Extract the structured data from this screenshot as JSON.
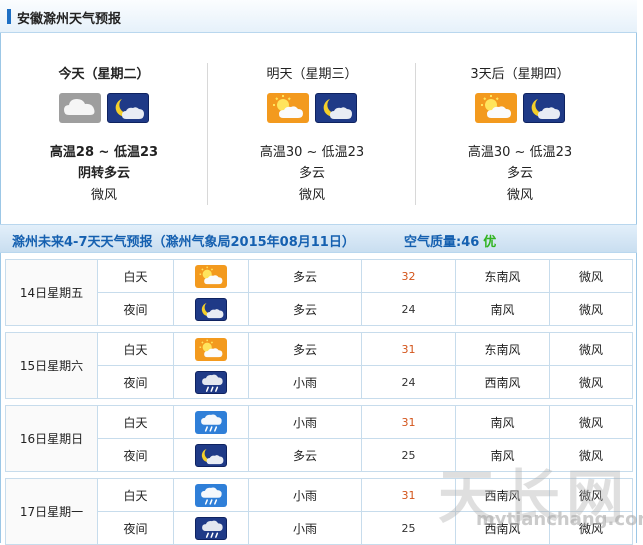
{
  "title": "安徽滁州天气预报",
  "today": [
    {
      "name": "今天（星期二）",
      "icons": [
        "cloud-icon",
        "night-cloud-icon"
      ],
      "temp": "高温28 ~ 低温23",
      "cond": "阴转多云",
      "wind": "微风"
    },
    {
      "name": "明天（星期三）",
      "icons": [
        "sun-cloud-icon",
        "night-cloud-icon"
      ],
      "temp": "高温30 ~ 低温23",
      "cond": "多云",
      "wind": "微风"
    },
    {
      "name": "3天后（星期四）",
      "icons": [
        "sun-cloud-icon",
        "night-cloud-icon"
      ],
      "temp": "高温30 ~ 低温23",
      "cond": "多云",
      "wind": "微风"
    }
  ],
  "sub": {
    "title": "滁州未来4-7天天气预报（滁州气象局2015年08月11日）",
    "aq_label": "空气质量:",
    "aq_value": "46",
    "aq_grade": "优"
  },
  "forecast": [
    {
      "date": "14日星期五",
      "rows": [
        {
          "period": "白天",
          "icon": "sun-cloud-icon",
          "cond": "多云",
          "temp": "32",
          "dir": "东南风",
          "wind": "微风"
        },
        {
          "period": "夜间",
          "icon": "night-cloud-icon",
          "cond": "多云",
          "temp": "24",
          "dir": "南风",
          "wind": "微风"
        }
      ]
    },
    {
      "date": "15日星期六",
      "rows": [
        {
          "period": "白天",
          "icon": "sun-cloud-icon",
          "cond": "多云",
          "temp": "31",
          "dir": "东南风",
          "wind": "微风"
        },
        {
          "period": "夜间",
          "icon": "night-rain-icon",
          "cond": "小雨",
          "temp": "24",
          "dir": "西南风",
          "wind": "微风"
        }
      ]
    },
    {
      "date": "16日星期日",
      "rows": [
        {
          "period": "白天",
          "icon": "rain-icon",
          "cond": "小雨",
          "temp": "31",
          "dir": "南风",
          "wind": "微风"
        },
        {
          "period": "夜间",
          "icon": "night-cloud-icon",
          "cond": "多云",
          "temp": "25",
          "dir": "南风",
          "wind": "微风"
        }
      ]
    },
    {
      "date": "17日星期一",
      "rows": [
        {
          "period": "白天",
          "icon": "rain-icon",
          "cond": "小雨",
          "temp": "31",
          "dir": "西南风",
          "wind": "微风"
        },
        {
          "period": "夜间",
          "icon": "night-rain-icon",
          "cond": "小雨",
          "temp": "25",
          "dir": "西南风",
          "wind": "微风"
        }
      ]
    }
  ],
  "watermark": {
    "big": "天长网",
    "small": "mytianchang.com"
  },
  "colors": {
    "accent": "#1d6fc4",
    "sub_text": "#1560b0",
    "aq_good": "#2fb31f",
    "high_temp": "#d3541a"
  }
}
